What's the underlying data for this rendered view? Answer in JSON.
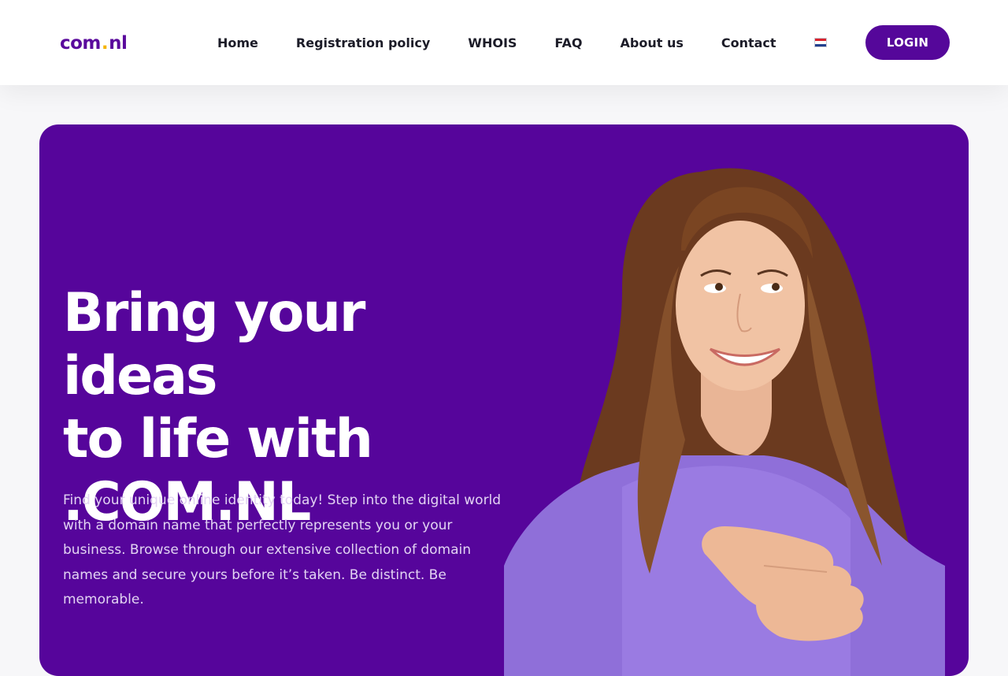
{
  "brand": {
    "logo_text_left": "com",
    "logo_dot": ".",
    "logo_text_right": "nl",
    "accent_color": "#55079a",
    "dot_color": "#f5b400"
  },
  "nav": {
    "items": [
      {
        "label": "Home"
      },
      {
        "label": "Registration policy"
      },
      {
        "label": "WHOIS"
      },
      {
        "label": "FAQ"
      },
      {
        "label": "About us"
      },
      {
        "label": "Contact"
      }
    ],
    "language_icon": "netherlands-flag-icon",
    "login_label": "LOGIN"
  },
  "hero": {
    "background_color": "#56059b",
    "title_line1": "Bring your ideas",
    "title_line2": "to life with",
    "title_line3": ".COM.NL",
    "description": "Find your unique online identity today! Step into the digital world with a domain name that perfectly represents you or your business. Browse through our extensive collection of domain names and secure yours before it’s taken. Be distinct. Be memorable.",
    "image_subject": "smiling woman pointing"
  }
}
